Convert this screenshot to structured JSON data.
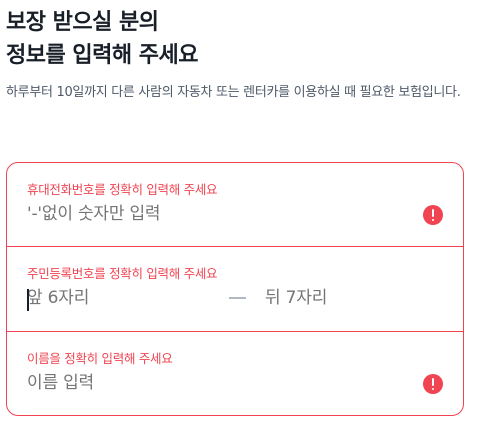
{
  "header": {
    "title_line1": "보장 받으실 분의",
    "title_line2": "정보를 입력해 주세요",
    "description": "하루부터 10일까지 다른 사람의 자동차 또는 렌터카를 이용하실 때 필요한 보험입니다."
  },
  "form": {
    "phone": {
      "error_label": "휴대전화번호를 정확히 입력해 주세요",
      "placeholder": "'-'없이 숫자만 입력",
      "icon": "error-icon"
    },
    "resident_number": {
      "error_label": "주민등록번호를 정확히 입력해 주세요",
      "front_placeholder": "앞 6자리",
      "back_placeholder": "뒤 7자리"
    },
    "name": {
      "error_label": "이름을 정확히 입력해 주세요",
      "placeholder": "이름 입력",
      "icon": "error-icon"
    }
  },
  "colors": {
    "error": "#f04452",
    "placeholder": "#8b95a1",
    "title": "#191f28",
    "description": "#4e5968"
  }
}
